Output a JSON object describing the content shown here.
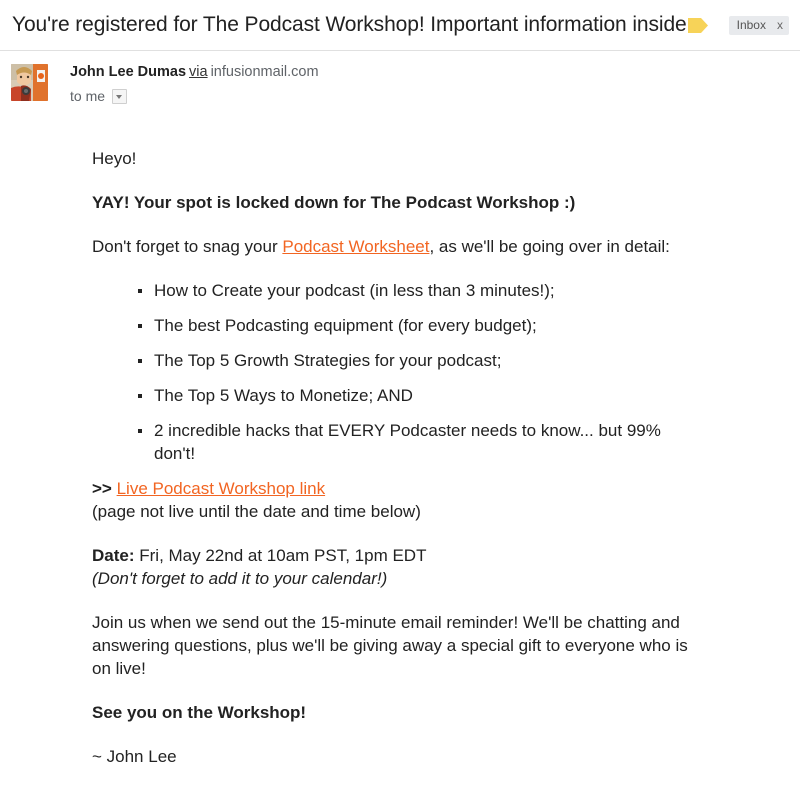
{
  "header": {
    "subject": "You're registered for The Podcast Workshop! Important information inside",
    "label_icon": "label-tag-icon",
    "inbox_chip": {
      "label": "Inbox",
      "close": "x"
    }
  },
  "sender": {
    "avatar_name": "sender-avatar",
    "name": "John Lee Dumas",
    "via": "via",
    "domain": "infusionmail.com",
    "recipient": "to me",
    "caret_icon": "chevron-down-icon"
  },
  "body": {
    "greeting": "Heyo!",
    "headline": "YAY! Your spot is locked down for The Podcast Workshop :)",
    "intro_before_link": "Don't forget to snag your ",
    "intro_link": "Podcast Worksheet",
    "intro_after_link": ", as we'll be going over in detail:",
    "bullets": [
      "How to Create your podcast (in less than 3 minutes!);",
      "The best Podcasting equipment (for every budget);",
      "The Top 5 Growth Strategies for your podcast;",
      "The Top 5 Ways to Monetize; AND",
      "2 incredible hacks that EVERY Podcaster needs to know... but 99% don't!"
    ],
    "link_prefix": ">>",
    "live_link": "Live Podcast Workshop link",
    "link_note": "(page not live until the date and time below)",
    "date_label": "Date:",
    "date_value": "Fri, May 22nd at 10am PST, 1pm EDT",
    "calendar_note": "(Don't forget to add it to your calendar!)",
    "join_paragraph": "Join us when we send out the 15-minute email reminder! We'll be chatting and answering questions, plus we'll be giving away a special gift to everyone who is on live!",
    "closing": "See you on the Workshop!",
    "signature": "~ John Lee"
  },
  "colors": {
    "link_orange": "#f26522",
    "label_yellow": "#f7d358",
    "chip_gray": "#e8eaed",
    "text": "#222222",
    "muted": "#5f6368"
  }
}
